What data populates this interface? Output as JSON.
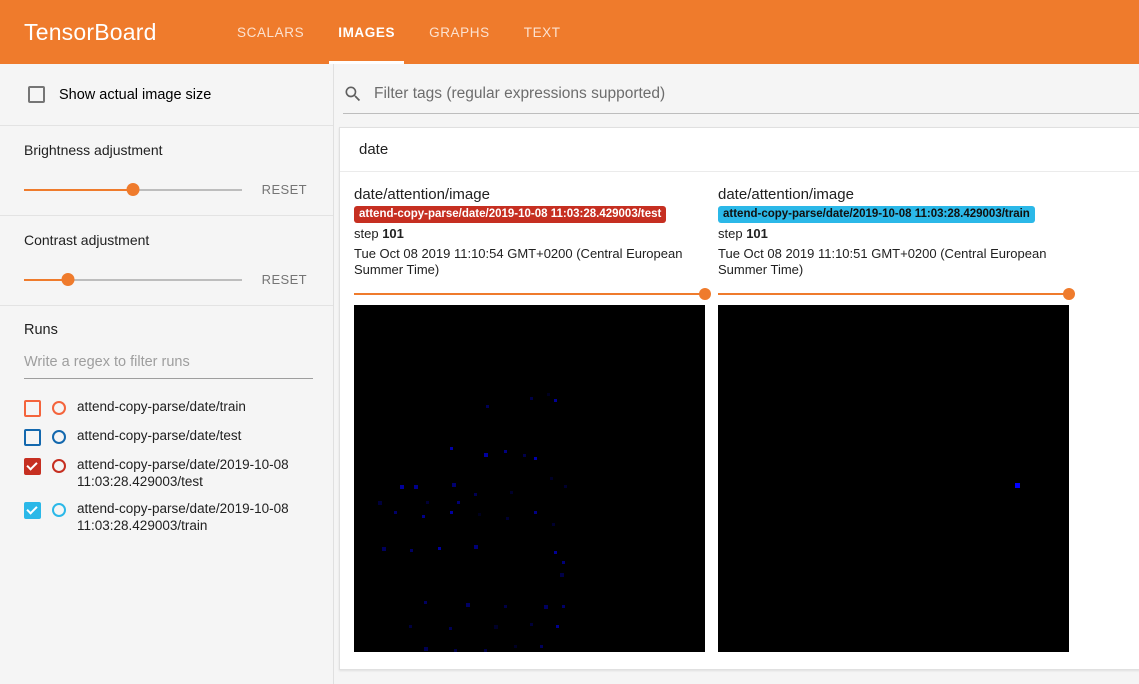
{
  "header": {
    "brand": "TensorBoard",
    "tabs": [
      {
        "label": "SCALARS",
        "active": false
      },
      {
        "label": "IMAGES",
        "active": true
      },
      {
        "label": "GRAPHS",
        "active": false
      },
      {
        "label": "TEXT",
        "active": false
      }
    ]
  },
  "sidebar": {
    "actual_size": {
      "label": "Show actual image size",
      "checked": false
    },
    "brightness": {
      "title": "Brightness adjustment",
      "reset_label": "RESET",
      "value_pct": 50
    },
    "contrast": {
      "title": "Contrast adjustment",
      "reset_label": "RESET",
      "value_pct": 20
    },
    "runs": {
      "title": "Runs",
      "filter_placeholder": "Write a regex to filter runs",
      "filter_value": "",
      "items": [
        {
          "label": "attend-copy-parse/date/train",
          "checked": false,
          "color": "#f4643c"
        },
        {
          "label": "attend-copy-parse/date/test",
          "checked": false,
          "color": "#1368ae"
        },
        {
          "label": "attend-copy-parse/date/2019-10-08 11:03:28.429003/test",
          "checked": true,
          "color": "#c62f21"
        },
        {
          "label": "attend-copy-parse/date/2019-10-08 11:03:28.429003/train",
          "checked": true,
          "color": "#2bb8e8"
        }
      ]
    }
  },
  "main": {
    "search": {
      "placeholder": "Filter tags (regular expressions supported)",
      "value": "",
      "icon": "search-icon"
    },
    "tag_group": {
      "name": "date"
    },
    "cards": [
      {
        "tag": "date/attention/image",
        "run_badge": "attend-copy-parse/date/2019-10-08 11:03:28.429003/test",
        "badge_bg": "#c62f21",
        "badge_fg": "#ffffff",
        "step_label": "step",
        "step_value": "101",
        "timestamp": "Tue Oct 08 2019 11:10:54 GMT+0200 (Central European Summer Time)",
        "slider_pct": 100
      },
      {
        "tag": "date/attention/image",
        "run_badge": "attend-copy-parse/date/2019-10-08 11:03:28.429003/train",
        "badge_bg": "#2bb8e8",
        "badge_fg": "#101010",
        "step_label": "step",
        "step_value": "101",
        "timestamp": "Tue Oct 08 2019 11:10:51 GMT+0200 (Central European Summer Time)",
        "slider_pct": 100
      }
    ]
  },
  "colors": {
    "accent": "#ef7b2c",
    "image_background": "#000000",
    "attention_dot": "#0000ff"
  }
}
